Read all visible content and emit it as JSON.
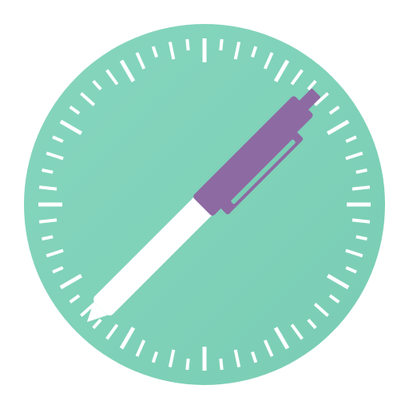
{
  "icon": {
    "name": "compass-dial-pen-icon",
    "colors": {
      "background": "#ffffff",
      "dial_face": "#79cdb3",
      "dial_face_light": "#86d6be",
      "tick_marks": "#ffffff",
      "pen_barrel": "#ffffff",
      "pen_cap": "#8e6aa3",
      "pen_tip": "#ffffff"
    },
    "tick_count": 60
  }
}
